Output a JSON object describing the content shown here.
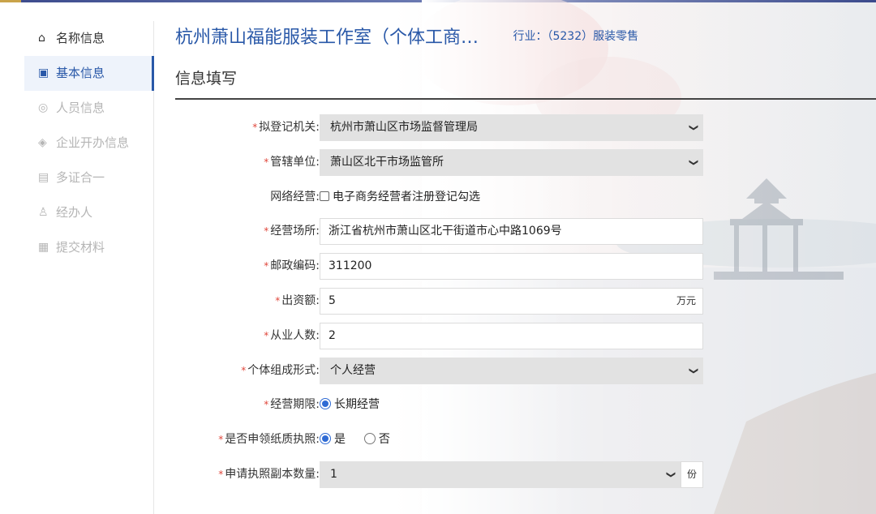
{
  "sidebar": {
    "items": [
      {
        "label": "名称信息",
        "icon": "home-icon",
        "glyph": "⌂"
      },
      {
        "label": "基本信息",
        "icon": "form-icon",
        "glyph": "▣"
      },
      {
        "label": "人员信息",
        "icon": "user-circle-icon",
        "glyph": "◎"
      },
      {
        "label": "企业开办信息",
        "icon": "shield-icon",
        "glyph": "◈"
      },
      {
        "label": "多证合一",
        "icon": "certificate-icon",
        "glyph": "▤"
      },
      {
        "label": "经办人",
        "icon": "person-icon",
        "glyph": "♙"
      },
      {
        "label": "提交材料",
        "icon": "document-icon",
        "glyph": "▦"
      }
    ]
  },
  "header": {
    "company": "杭州萧山福能服装工作室（个体工商…",
    "industry": "行业：（5232）服装零售"
  },
  "section": {
    "title": "信息填写"
  },
  "form": {
    "registration_authority": {
      "label": "拟登记机关:",
      "value": "杭州市萧山区市场监督管理局"
    },
    "jurisdiction": {
      "label": "管辖单位:",
      "value": "萧山区北干市场监管所"
    },
    "online_business": {
      "label": "网络经营:",
      "option": "电子商务经营者注册登记勾选"
    },
    "business_premises": {
      "label": "经营场所:",
      "value": "浙江省杭州市萧山区北干街道市心中路1069号"
    },
    "postal_code": {
      "label": "邮政编码:",
      "value": "311200"
    },
    "capital": {
      "label": "出资额:",
      "value": "5",
      "unit": "万元"
    },
    "employees": {
      "label": "从业人数:",
      "value": "2"
    },
    "composition": {
      "label": "个体组成形式:",
      "value": "个人经营"
    },
    "business_term": {
      "label": "经营期限:",
      "option": "长期经营"
    },
    "paper_license": {
      "label": "是否申领纸质执照:",
      "yes": "是",
      "no": "否"
    },
    "license_copies": {
      "label": "申请执照副本数量:",
      "value": "1",
      "unit": "份"
    }
  },
  "colors": {
    "accent": "#2958a8",
    "required": "#e0463b",
    "radio": "#2f6bd4"
  }
}
